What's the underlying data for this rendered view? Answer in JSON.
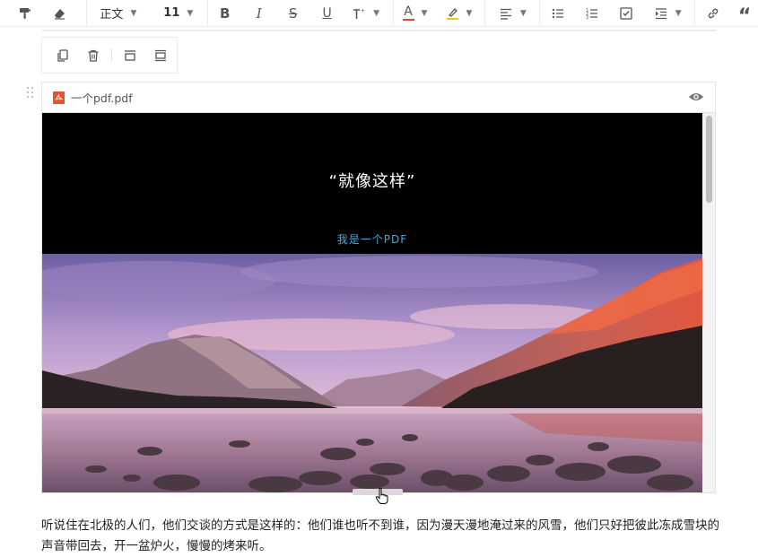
{
  "toolbar": {
    "style_select": "正文",
    "size_select": "11",
    "icons": [
      "format-painter-icon",
      "eraser-icon",
      "bold-icon",
      "italic-icon",
      "strikethrough-icon",
      "underline-icon",
      "superscript-icon",
      "font-color-icon",
      "highlight-icon",
      "align-left-icon",
      "bullet-list-icon",
      "ordered-list-icon",
      "checklist-icon",
      "indent-icon",
      "link-icon",
      "quote-icon"
    ],
    "bold_glyph": "B",
    "italic_glyph": "I",
    "strike_glyph": "S",
    "underline_glyph": "U",
    "font_color_glyph": "A",
    "quote_glyph": "“",
    "font_color": "#e8442c",
    "highlight_color": "#f5c518"
  },
  "pdf": {
    "file_name": "一个pdf.pdf",
    "page_title": "“就像这样”",
    "page_subtitle": "我是一个PDF"
  },
  "paragraph": {
    "text": "听说住在北极的人们，他们交谈的方式是这样的：他们谁也听不到谁，因为漫天漫地淹过来的风雪，他们只好把彼此冻成雪块的声音带回去，开一盆炉火，慢慢的烤来听。"
  }
}
